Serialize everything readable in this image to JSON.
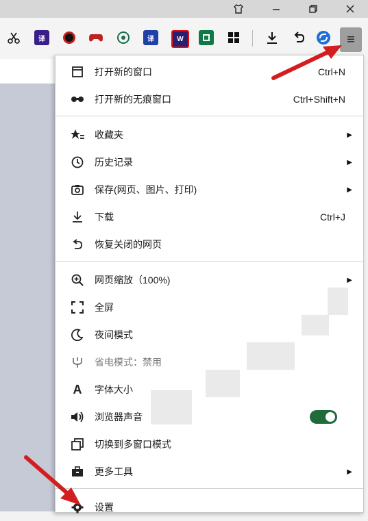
{
  "titlebar": {
    "icons": [
      "shirt-icon",
      "minimize-icon",
      "restore-icon",
      "close-icon"
    ]
  },
  "toolbar": {
    "extensions": [
      {
        "name": "scissors-icon"
      },
      {
        "name": "translate-ext-icon",
        "glyph": "译",
        "color": "#3a1f8a"
      },
      {
        "name": "record-ext-icon",
        "color": "#c0201f"
      },
      {
        "name": "gamepad-ext-icon",
        "color": "#c0201f"
      },
      {
        "name": "fan-ext-icon",
        "color": "#1a6e4a"
      },
      {
        "name": "translate2-ext-icon",
        "glyph": "译",
        "color": "#1e40a8"
      },
      {
        "name": "w-ext-icon",
        "glyph": "W",
        "color": "#2a1e6e"
      },
      {
        "name": "book-ext-icon",
        "color": "#0f7a45"
      },
      {
        "name": "apps-grid-icon"
      },
      {
        "name": "download-icon"
      },
      {
        "name": "undo-icon"
      },
      {
        "name": "sync-ext-icon",
        "color": "#1f6fd6"
      }
    ],
    "menu_glyph": "≡"
  },
  "menu": {
    "items": [
      {
        "id": "new-window",
        "label": "打开新的窗口",
        "shortcut": "Ctrl+N",
        "icon": "window-icon",
        "glyph": "▭"
      },
      {
        "id": "new-incognito",
        "label": "打开新的无痕窗口",
        "shortcut": "Ctrl+Shift+N",
        "icon": "incognito-icon",
        "glyph": "∞"
      },
      {
        "id": "bookmarks",
        "label": "收藏夹",
        "arrow": "▶",
        "icon": "star-list-icon",
        "glyph": "☆"
      },
      {
        "id": "history",
        "label": "历史记录",
        "arrow": "▶",
        "icon": "clock-icon",
        "glyph": "◷"
      },
      {
        "id": "save",
        "label": "保存(网页、图片、打印)",
        "arrow": "▶",
        "icon": "camera-icon",
        "glyph": "◙"
      },
      {
        "id": "downloads",
        "label": "下载",
        "shortcut": "Ctrl+J",
        "icon": "download-icon",
        "glyph": "⤓"
      },
      {
        "id": "restore",
        "label": "恢复关闭的网页",
        "icon": "restore-tab-icon",
        "glyph": "↶"
      },
      {
        "id": "zoom",
        "label": "网页缩放（100%)",
        "arrow": "▶",
        "icon": "zoom-in-icon",
        "glyph": "⊕"
      },
      {
        "id": "fullscreen",
        "label": "全屏",
        "icon": "fullscreen-icon",
        "glyph": "⛶"
      },
      {
        "id": "night",
        "label": "夜间模式",
        "icon": "moon-icon",
        "glyph": "☾"
      },
      {
        "id": "power",
        "label": "省电模式：禁用",
        "icon": "plug-icon",
        "glyph": "ψ"
      },
      {
        "id": "font",
        "label": "字体大小",
        "icon": "font-size-icon",
        "glyph": "A"
      },
      {
        "id": "sound",
        "label": "浏览器声音",
        "icon": "speaker-icon",
        "glyph": "🔊",
        "toggle_on": true
      },
      {
        "id": "multiwindow",
        "label": "切换到多窗口模式",
        "icon": "multi-window-icon",
        "glyph": "⧉"
      },
      {
        "id": "more-tools",
        "label": "更多工具",
        "arrow": "▶",
        "icon": "toolbox-icon",
        "glyph": "▣"
      },
      {
        "id": "settings",
        "label": "设置",
        "icon": "gear-icon",
        "glyph": "⚙"
      }
    ]
  },
  "colors": {
    "arrow": "#d21e1e",
    "toggle": "#1f6b3a"
  }
}
